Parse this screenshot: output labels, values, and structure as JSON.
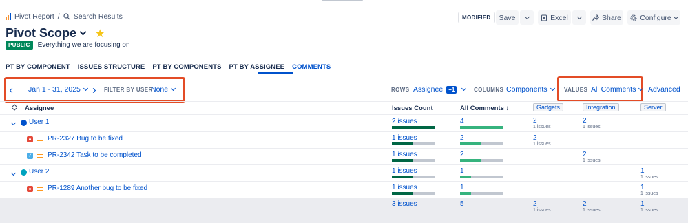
{
  "breadcrumb": {
    "parent": "Pivot Report",
    "separator": "/",
    "current": "Search Results"
  },
  "report": {
    "title": "Pivot Scope",
    "badge": "PUBLIC",
    "description": "Everything we are focusing on"
  },
  "actions": {
    "status": "MODIFIED",
    "save": "Save",
    "excel": "Excel",
    "share": "Share",
    "configure": "Configure"
  },
  "tabs": [
    {
      "label": "PT BY COMPONENT",
      "active": false
    },
    {
      "label": "ISSUES STRUCTURE",
      "active": false
    },
    {
      "label": "PT BY COMPONENTS",
      "active": false
    },
    {
      "label": "PT BY ASSIGNEE",
      "active": false
    },
    {
      "label": "COMMENTS",
      "active": true
    }
  ],
  "filters": {
    "date_range": "Jan 1 - 31, 2025",
    "filter_by_user_label": "FILTER BY USER",
    "filter_by_user_value": "None",
    "rows_label": "ROWS",
    "rows_value": "Assignee",
    "rows_extra": "+1",
    "columns_label": "COLUMNS",
    "columns_value": "Components",
    "values_label": "VALUES",
    "values_value": "All Comments",
    "advanced": "Advanced"
  },
  "table": {
    "headers": {
      "assignee": "Assignee",
      "issues_count": "Issues Count",
      "all_comments": "All Comments",
      "sort_arrow": "↓"
    },
    "components": [
      "Gadgets",
      "Integration",
      "Server"
    ],
    "rows": [
      {
        "label": "User 1",
        "issues": "2 issues",
        "issues_fill": 1.0,
        "comments": "4",
        "comments_fill": 1.0,
        "gadgets": "2",
        "gadgets_sub": "1 issues",
        "integration": "2",
        "integration_sub": "1 issues",
        "server": "",
        "server_sub": ""
      },
      {
        "label": "PR-2327  Bug to be fixed",
        "issues": "1 issues",
        "issues_fill": 0.5,
        "comments": "2",
        "comments_fill": 0.5,
        "gadgets": "2",
        "gadgets_sub": "1 issues",
        "integration": "",
        "integration_sub": "",
        "server": "",
        "server_sub": ""
      },
      {
        "label": "PR-2342 Task to be completed",
        "issues": "1 issues",
        "issues_fill": 0.5,
        "comments": "2",
        "comments_fill": 0.5,
        "gadgets": "",
        "gadgets_sub": "",
        "integration": "2",
        "integration_sub": "1 issues",
        "server": "",
        "server_sub": ""
      },
      {
        "label": "User 2",
        "issues": "1 issues",
        "issues_fill": 0.5,
        "comments": "1",
        "comments_fill": 0.25,
        "gadgets": "",
        "gadgets_sub": "",
        "integration": "",
        "integration_sub": "",
        "server": "1",
        "server_sub": "1 issues"
      },
      {
        "label": "PR-1289 Another bug to be fixed",
        "issues": "1 issues",
        "issues_fill": 0.5,
        "comments": "1",
        "comments_fill": 0.25,
        "gadgets": "",
        "gadgets_sub": "",
        "integration": "",
        "integration_sub": "",
        "server": "1",
        "server_sub": "1 issues"
      }
    ],
    "totals": {
      "issues": "3 issues",
      "comments": "5",
      "gadgets": "2",
      "gadgets_sub": "1 issues",
      "integration": "2",
      "integration_sub": "1 issues",
      "server": "1",
      "server_sub": "1 issues"
    }
  },
  "colors": {
    "accent": "#0052cc",
    "highlight_box": "#e34c26",
    "public_badge": "#00875a",
    "bar_dark": "#006644",
    "bar_green": "#36b37e",
    "bug": "#e5493a",
    "task": "#4bade8",
    "star": "#f5c518"
  },
  "icons": [
    "pivot-report-icon",
    "search-icon",
    "chevron-down-icon",
    "star-icon",
    "chevron-left-icon",
    "chevron-right-icon",
    "share-icon",
    "gear-icon",
    "excel-icon",
    "sort-icon",
    "bug-icon",
    "task-icon",
    "priority-medium-icon",
    "avatar-icon"
  ]
}
